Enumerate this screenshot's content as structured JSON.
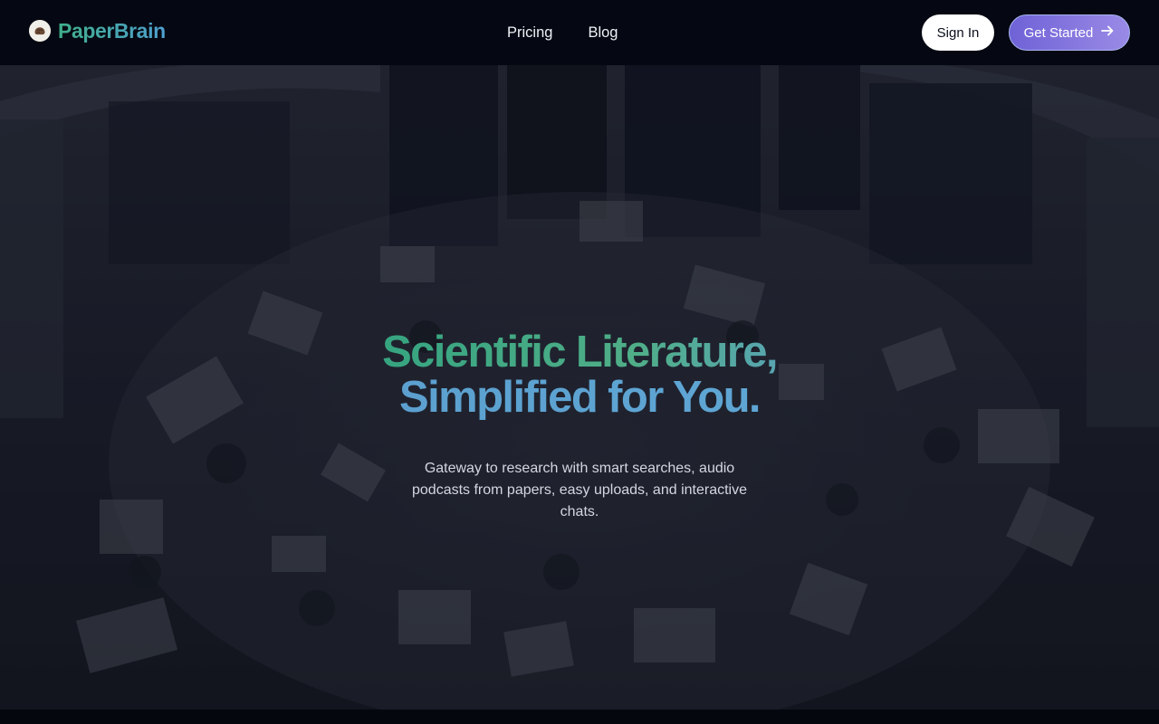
{
  "nav": {
    "brand_name": "PaperBrain",
    "brand_logo_icon": "brain-logo-icon",
    "links": [
      {
        "label": "Pricing"
      },
      {
        "label": "Blog"
      }
    ],
    "sign_in_label": "Sign In",
    "get_started_label": "Get Started",
    "get_started_icon": "arrow-right-icon"
  },
  "hero": {
    "title_line_1": "Scientific Literature,",
    "title_line_2": "Simplified for You.",
    "subtitle": "Gateway to research with smart searches, audio podcasts from papers, easy uploads, and interactive chats.",
    "background": "library-reading-room-photo"
  },
  "colors": {
    "brand_green": "#3fae8a",
    "brand_blue": "#4f9fd0",
    "cta_purple": "#7b6ddc",
    "nav_bg": "#050812"
  }
}
